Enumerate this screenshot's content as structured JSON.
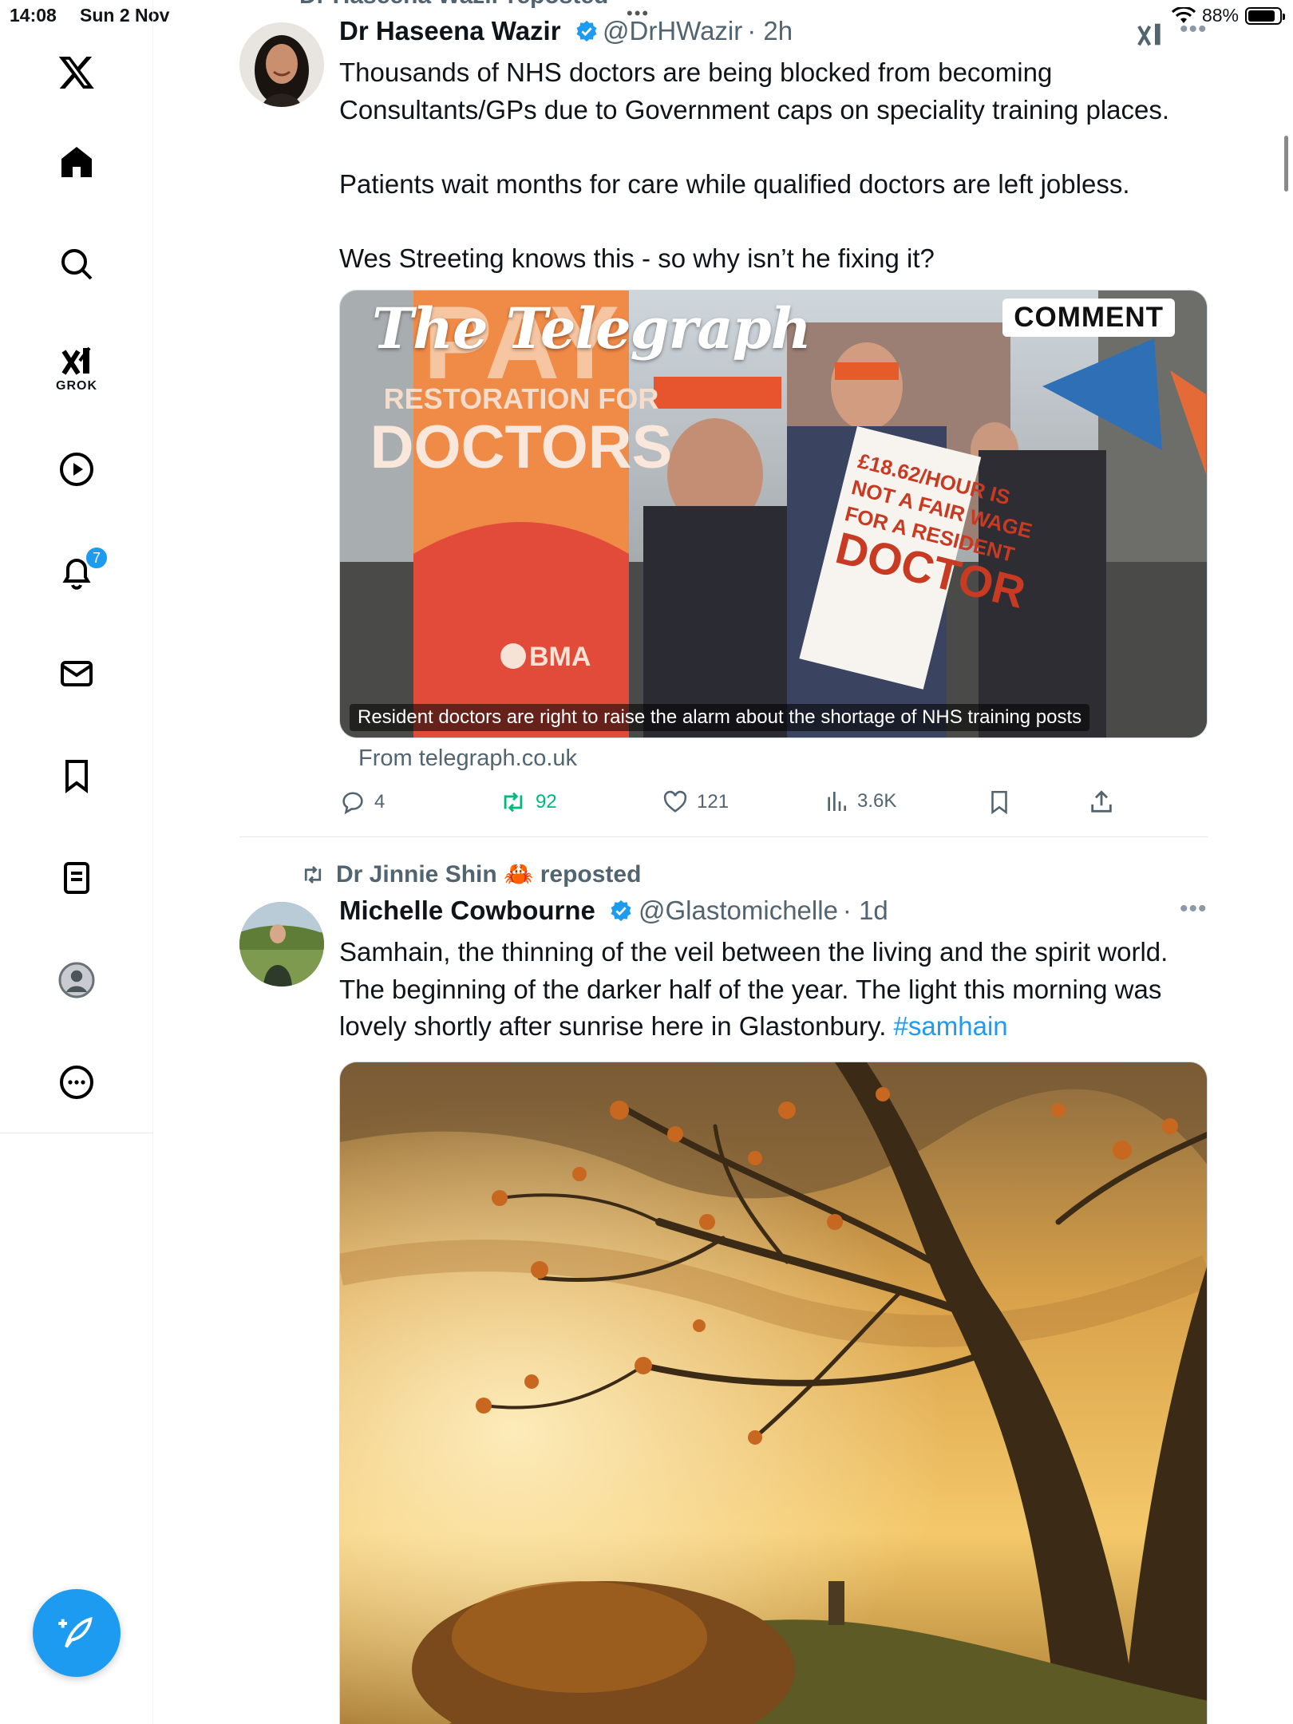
{
  "status_bar": {
    "time": "14:08",
    "date": "Sun 2 Nov",
    "battery": "88%",
    "battery_level": 0.88
  },
  "sidebar": {
    "grok_label": "GROK",
    "notifications_badge": "7",
    "items": [
      "x-logo",
      "home",
      "explore",
      "grok",
      "video",
      "notifications",
      "messages",
      "bookmarks",
      "lists",
      "profile",
      "more"
    ]
  },
  "tweets": [
    {
      "repost_by": "Dr Haseena Wazir reposted",
      "author": "Dr Haseena Wazir",
      "handle": "@DrHWazir",
      "time": "· 2h",
      "lines": [
        "Thousands of NHS doctors are being blocked from becoming",
        "Consultants/GPs due to Government caps on speciality training places.",
        "",
        "Patients wait months for care while qualified doctors are left jobless.",
        "",
        "Wes Streeting knows this - so why isn’t he fixing it?"
      ],
      "card": {
        "masthead": "The Telegraph",
        "tag": "COMMENT",
        "sign_pay": "PAY",
        "sign_line1": "RESTORATION FOR",
        "sign_line2": "DOCTORS",
        "sign_bma": "BMA",
        "placard_lines": [
          "£18.62/HOUR IS",
          "NOT A FAIR WAGE",
          "FOR A RESIDENT",
          "DOCTOR"
        ],
        "caption": "Resident doctors are right to raise the alarm about the shortage of NHS training posts",
        "source": "From telegraph.co.uk"
      },
      "stats": {
        "replies": "4",
        "reposts": "92",
        "likes": "121",
        "views": "3.6K"
      }
    },
    {
      "repost_by": "Dr Jinnie Shin 🦀 reposted",
      "author": "Michelle Cowbourne",
      "handle": "@Glastomichelle",
      "time": "· 1d",
      "lines": [
        "Samhain, the thinning of the veil between the living and the spirit world.",
        "The beginning of the darker half of the year. The light this morning was",
        "lovely shortly after sunrise here in Glastonbury."
      ],
      "hashtag": "#samhain"
    }
  ],
  "colors": {
    "accent": "#1d9bf0",
    "repost_green": "#00ba7c",
    "secondary_text": "#536471"
  }
}
